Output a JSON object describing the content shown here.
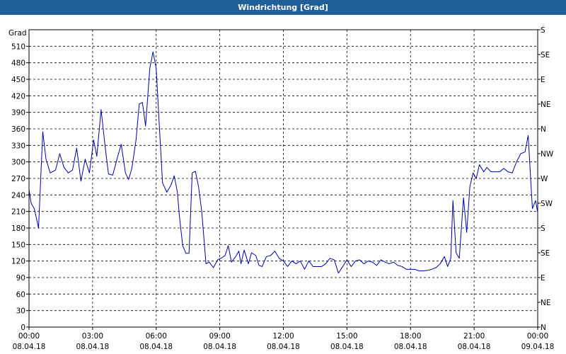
{
  "window": {
    "title": "Windrichtung [Grad]"
  },
  "colors": {
    "titlebar": "#1f5f9a",
    "series": "#0000b4",
    "grid": "#000000"
  },
  "chart_data": {
    "type": "line",
    "title": "Windrichtung [Grad]",
    "ylabel": "Grad",
    "ylim": [
      0,
      540
    ],
    "xlim_hours": [
      0,
      24
    ],
    "grid": true,
    "y_ticks": [
      0,
      30,
      60,
      90,
      120,
      150,
      180,
      210,
      240,
      270,
      300,
      330,
      360,
      390,
      420,
      450,
      480,
      510
    ],
    "y2_ticks": [
      {
        "value": 0,
        "label": "N"
      },
      {
        "value": 45,
        "label": "NE"
      },
      {
        "value": 90,
        "label": "E"
      },
      {
        "value": 135,
        "label": "SE"
      },
      {
        "value": 180,
        "label": "S"
      },
      {
        "value": 225,
        "label": "SW"
      },
      {
        "value": 270,
        "label": "W"
      },
      {
        "value": 315,
        "label": "NW"
      },
      {
        "value": 360,
        "label": "N"
      },
      {
        "value": 405,
        "label": "NE"
      },
      {
        "value": 450,
        "label": "E"
      },
      {
        "value": 495,
        "label": "SE"
      },
      {
        "value": 540,
        "label": "S"
      }
    ],
    "x_ticks": [
      {
        "hour": 0,
        "time": "00:00",
        "date": "08.04.18"
      },
      {
        "hour": 3,
        "time": "03:00",
        "date": "08.04.18"
      },
      {
        "hour": 6,
        "time": "06:00",
        "date": "08.04.18"
      },
      {
        "hour": 9,
        "time": "09:00",
        "date": "08.04.18"
      },
      {
        "hour": 12,
        "time": "12:00",
        "date": "08.04.18"
      },
      {
        "hour": 15,
        "time": "15:00",
        "date": "08.04.18"
      },
      {
        "hour": 18,
        "time": "18:00",
        "date": "08.04.18"
      },
      {
        "hour": 21,
        "time": "21:00",
        "date": "08.04.18"
      },
      {
        "hour": 24,
        "time": "00:00",
        "date": "09.04.18"
      }
    ],
    "series": [
      {
        "points": [
          [
            0.0,
            250
          ],
          [
            0.1,
            225
          ],
          [
            0.25,
            215
          ],
          [
            0.45,
            180
          ],
          [
            0.65,
            355
          ],
          [
            0.8,
            305
          ],
          [
            1.0,
            280
          ],
          [
            1.25,
            285
          ],
          [
            1.45,
            315
          ],
          [
            1.65,
            290
          ],
          [
            1.85,
            280
          ],
          [
            2.05,
            285
          ],
          [
            2.25,
            325
          ],
          [
            2.45,
            265
          ],
          [
            2.65,
            305
          ],
          [
            2.85,
            280
          ],
          [
            3.05,
            340
          ],
          [
            3.2,
            310
          ],
          [
            3.4,
            395
          ],
          [
            3.6,
            325
          ],
          [
            3.75,
            278
          ],
          [
            3.95,
            276
          ],
          [
            4.15,
            305
          ],
          [
            4.35,
            332
          ],
          [
            4.55,
            280
          ],
          [
            4.7,
            268
          ],
          [
            4.85,
            288
          ],
          [
            5.05,
            340
          ],
          [
            5.2,
            405
          ],
          [
            5.35,
            408
          ],
          [
            5.5,
            365
          ],
          [
            5.7,
            470
          ],
          [
            5.85,
            500
          ],
          [
            6.0,
            470
          ],
          [
            6.15,
            365
          ],
          [
            6.3,
            262
          ],
          [
            6.5,
            245
          ],
          [
            6.7,
            258
          ],
          [
            6.85,
            275
          ],
          [
            7.0,
            245
          ],
          [
            7.1,
            200
          ],
          [
            7.25,
            148
          ],
          [
            7.4,
            134
          ],
          [
            7.55,
            134
          ],
          [
            7.7,
            280
          ],
          [
            7.85,
            283
          ],
          [
            8.0,
            255
          ],
          [
            8.15,
            210
          ],
          [
            8.35,
            115
          ],
          [
            8.5,
            118
          ],
          [
            8.7,
            108
          ],
          [
            8.9,
            122
          ],
          [
            9.1,
            126
          ],
          [
            9.25,
            130
          ],
          [
            9.4,
            148
          ],
          [
            9.55,
            118
          ],
          [
            9.75,
            128
          ],
          [
            9.9,
            138
          ],
          [
            10.0,
            115
          ],
          [
            10.15,
            140
          ],
          [
            10.35,
            115
          ],
          [
            10.5,
            135
          ],
          [
            10.7,
            130
          ],
          [
            10.85,
            112
          ],
          [
            11.0,
            110
          ],
          [
            11.2,
            128
          ],
          [
            11.4,
            130
          ],
          [
            11.6,
            138
          ],
          [
            11.8,
            125
          ],
          [
            12.0,
            120
          ],
          [
            12.2,
            110
          ],
          [
            12.4,
            120
          ],
          [
            12.6,
            115
          ],
          [
            12.8,
            120
          ],
          [
            13.0,
            105
          ],
          [
            13.2,
            120
          ],
          [
            13.4,
            110
          ],
          [
            13.6,
            110
          ],
          [
            13.8,
            110
          ],
          [
            14.0,
            115
          ],
          [
            14.2,
            125
          ],
          [
            14.4,
            122
          ],
          [
            14.6,
            98
          ],
          [
            14.8,
            110
          ],
          [
            15.0,
            122
          ],
          [
            15.2,
            110
          ],
          [
            15.4,
            120
          ],
          [
            15.6,
            122
          ],
          [
            15.8,
            115
          ],
          [
            16.0,
            120
          ],
          [
            16.2,
            118
          ],
          [
            16.4,
            112
          ],
          [
            16.6,
            122
          ],
          [
            16.8,
            118
          ],
          [
            17.0,
            115
          ],
          [
            17.2,
            118
          ],
          [
            17.4,
            112
          ],
          [
            17.6,
            110
          ],
          [
            17.8,
            105
          ],
          [
            18.0,
            105
          ],
          [
            18.2,
            105
          ],
          [
            18.4,
            102
          ],
          [
            18.6,
            102
          ],
          [
            18.8,
            103
          ],
          [
            19.0,
            105
          ],
          [
            19.2,
            108
          ],
          [
            19.4,
            115
          ],
          [
            19.6,
            128
          ],
          [
            19.75,
            110
          ],
          [
            19.9,
            125
          ],
          [
            20.0,
            230
          ],
          [
            20.15,
            135
          ],
          [
            20.3,
            125
          ],
          [
            20.5,
            235
          ],
          [
            20.65,
            172
          ],
          [
            20.8,
            255
          ],
          [
            20.95,
            280
          ],
          [
            21.1,
            270
          ],
          [
            21.25,
            295
          ],
          [
            21.45,
            282
          ],
          [
            21.6,
            290
          ],
          [
            21.8,
            282
          ],
          [
            22.0,
            282
          ],
          [
            22.2,
            282
          ],
          [
            22.4,
            288
          ],
          [
            22.6,
            282
          ],
          [
            22.8,
            280
          ],
          [
            23.0,
            300
          ],
          [
            23.2,
            315
          ],
          [
            23.4,
            318
          ],
          [
            23.55,
            348
          ],
          [
            23.75,
            215
          ],
          [
            23.9,
            230
          ],
          [
            24.0,
            208
          ]
        ]
      }
    ]
  }
}
